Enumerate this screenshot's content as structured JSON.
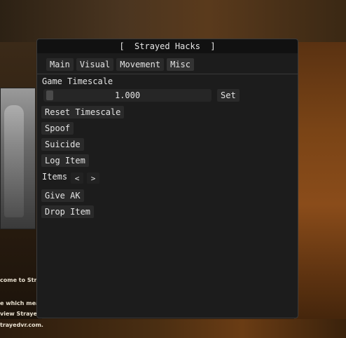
{
  "background": {
    "text_lines": [
      "come to Stray",
      "e which mea",
      "view Straye",
      "trayedvr.com."
    ]
  },
  "window": {
    "title": "[  Strayed Hacks  ]"
  },
  "tabs": [
    {
      "label": "Main"
    },
    {
      "label": "Visual"
    },
    {
      "label": "Movement"
    },
    {
      "label": "Misc",
      "active": true
    }
  ],
  "misc": {
    "timescale_label": "Game Timescale",
    "timescale_value": "1.000",
    "set_label": "Set",
    "reset_label": "Reset Timescale",
    "spoof_label": "Spoof",
    "suicide_label": "Suicide",
    "log_item_label": "Log Item",
    "items_label": "Items",
    "prev_label": "<",
    "next_label": ">",
    "give_label": "Give AK",
    "drop_label": "Drop Item"
  },
  "colors": {
    "window_bg": "#1c1c1c",
    "titlebar_bg": "#111111",
    "button_bg": "#2a2a2a",
    "text": "#e4e4e4"
  }
}
